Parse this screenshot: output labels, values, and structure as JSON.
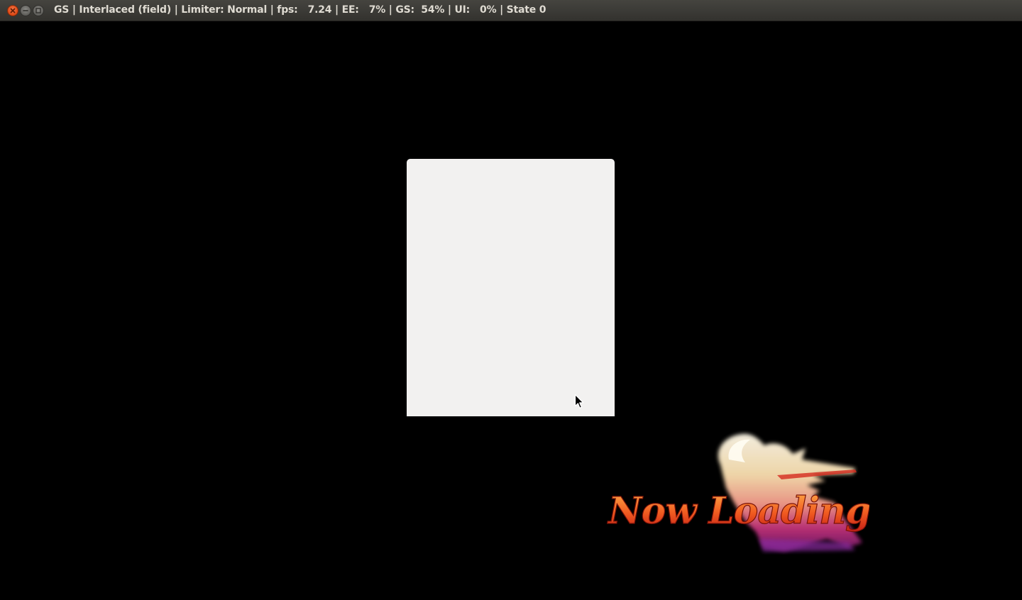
{
  "window": {
    "title": "GS | Interlaced (field) | Limiter: Normal | fps:   7.24 | EE:   7% | GS:  54% | UI:   0% | State 0",
    "controls": {
      "close": "close-icon",
      "minimize": "minimize-icon",
      "maximize": "maximize-icon"
    }
  },
  "dialog": {
    "background": "#f2f1f0"
  },
  "loading_screen": {
    "text": "Now Loading",
    "colors": {
      "text_top": "#ff8a3c",
      "text_bottom": "#d8241a",
      "flame_light": "#fff6e0",
      "flame_mid": "#f7b48a",
      "flame_dark": "#7a1d6e"
    }
  },
  "colors": {
    "titlebar": "#3c3b37",
    "title_text": "#dfdbd2",
    "background": "#000000"
  }
}
